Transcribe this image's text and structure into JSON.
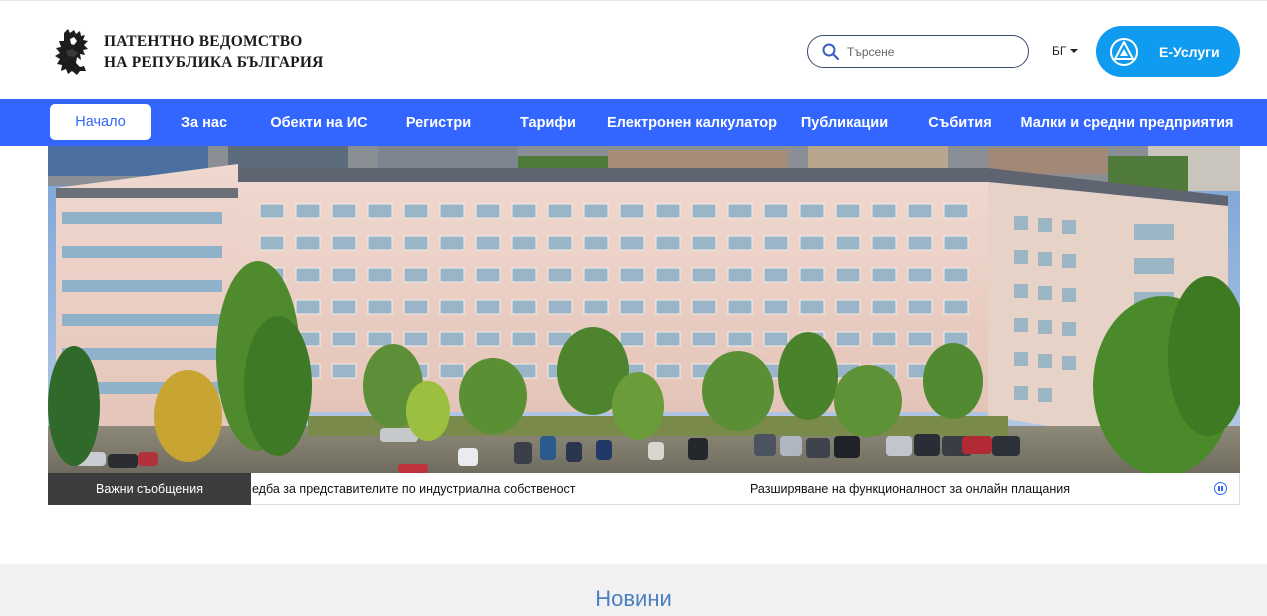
{
  "header": {
    "logo_line1": "ПАТЕНТНО ВЕДОМСТВО",
    "logo_line2": "НА РЕПУБЛИКА БЪЛГАРИЯ",
    "search_placeholder": "Търсене",
    "lang": "БГ",
    "eservices_label": "Е-Услуги"
  },
  "nav": {
    "items": [
      {
        "label": "Начало",
        "active": true
      },
      {
        "label": "За нас"
      },
      {
        "label": "Обекти на ИС"
      },
      {
        "label": "Регистри"
      },
      {
        "label": "Тарифи"
      },
      {
        "label": "Електронен калкулатор"
      },
      {
        "label": "Публикации"
      },
      {
        "label": "Събития"
      },
      {
        "label": "Малки и средни предприятия"
      }
    ]
  },
  "ticker": {
    "label": "Важни съобщения",
    "items": [
      "едба за представителите по индустриална собственост",
      "Разширяване на функционалност за онлайн плащания"
    ]
  },
  "news": {
    "title": "Новини"
  },
  "colors": {
    "nav_blue": "#3366ff",
    "eservices_blue": "#0f9bf0",
    "news_title": "#4a7fc1"
  }
}
